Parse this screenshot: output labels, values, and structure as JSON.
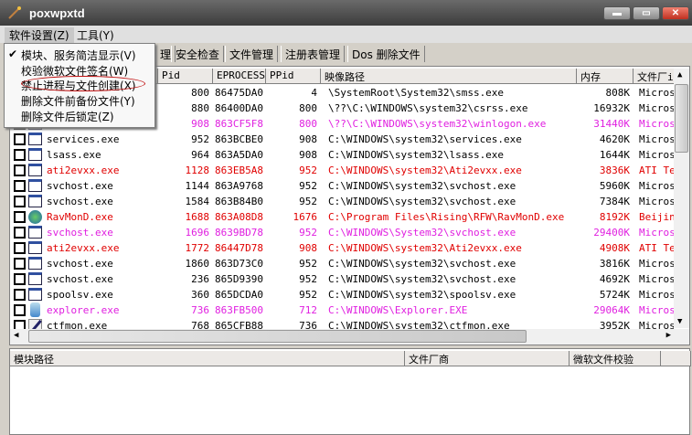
{
  "window": {
    "title": "poxwpxtd",
    "minimize": "▬",
    "maximize": "▭",
    "close": "✕"
  },
  "menubar": [
    {
      "label": "软件设置(Z)"
    },
    {
      "label": "工具(Y)"
    }
  ],
  "dropdown": {
    "items": [
      {
        "label": "模块、服务简洁显示(V)",
        "checked": true
      },
      {
        "label": "校验微软文件签名(W)"
      },
      {
        "label": "禁止进程与文件创建(X)",
        "highlighted": true
      },
      {
        "label": "删除文件前备份文件(Y)"
      },
      {
        "label": "删除文件后锁定(Z)"
      }
    ]
  },
  "tabs": [
    "理",
    "安全检查",
    "文件管理",
    "注册表管理",
    "Dos 删除文件"
  ],
  "table": {
    "columns": [
      "Pid",
      "EPROCESS",
      "PPid",
      "映像路径",
      "内存",
      "文件厂i"
    ],
    "rows": [
      {
        "name": "",
        "pid": "800",
        "eprocess": "86475DA0",
        "ppid": "4",
        "path": "\\SystemRoot\\System32\\smss.exe",
        "mem": "808K",
        "vendor": "Micros",
        "color": ""
      },
      {
        "name": "",
        "pid": "880",
        "eprocess": "86400DA0",
        "ppid": "800",
        "path": "\\??\\C:\\WINDOWS\\system32\\csrss.exe",
        "mem": "16932K",
        "vendor": "Micros",
        "color": ""
      },
      {
        "name": "",
        "pid": "908",
        "eprocess": "863CF5F8",
        "ppid": "800",
        "path": "\\??\\C:\\WINDOWS\\system32\\winlogon.exe",
        "mem": "31440K",
        "vendor": "Micros",
        "color": "m"
      },
      {
        "name": "services.exe",
        "pid": "952",
        "eprocess": "863BCBE0",
        "ppid": "908",
        "path": "C:\\WINDOWS\\system32\\services.exe",
        "mem": "4620K",
        "vendor": "Micros",
        "color": ""
      },
      {
        "name": "lsass.exe",
        "pid": "964",
        "eprocess": "863A5DA0",
        "ppid": "908",
        "path": "C:\\WINDOWS\\system32\\lsass.exe",
        "mem": "1644K",
        "vendor": "Micros",
        "color": ""
      },
      {
        "name": "ati2evxx.exe",
        "pid": "1128",
        "eprocess": "863EB5A8",
        "ppid": "952",
        "path": "C:\\WINDOWS\\system32\\Ati2evxx.exe",
        "mem": "3836K",
        "vendor": "ATI Te",
        "color": "r"
      },
      {
        "name": "svchost.exe",
        "pid": "1144",
        "eprocess": "863A9768",
        "ppid": "952",
        "path": "C:\\WINDOWS\\system32\\svchost.exe",
        "mem": "5960K",
        "vendor": "Micros",
        "color": ""
      },
      {
        "name": "svchost.exe",
        "pid": "1584",
        "eprocess": "863B84B0",
        "ppid": "952",
        "path": "C:\\WINDOWS\\system32\\svchost.exe",
        "mem": "7384K",
        "vendor": "Micros",
        "color": ""
      },
      {
        "name": "RavMonD.exe",
        "pid": "1688",
        "eprocess": "863A08D8",
        "ppid": "1676",
        "path": "C:\\Program Files\\Rising\\RFW\\RavMonD.exe",
        "mem": "8192K",
        "vendor": "Beijin",
        "color": "r",
        "icon": "globe"
      },
      {
        "name": "svchost.exe",
        "pid": "1696",
        "eprocess": "8639BD78",
        "ppid": "952",
        "path": "C:\\WINDOWS\\System32\\svchost.exe",
        "mem": "29400K",
        "vendor": "Micros",
        "color": "m"
      },
      {
        "name": "ati2evxx.exe",
        "pid": "1772",
        "eprocess": "86447D78",
        "ppid": "908",
        "path": "C:\\WINDOWS\\system32\\Ati2evxx.exe",
        "mem": "4908K",
        "vendor": "ATI Te",
        "color": "r"
      },
      {
        "name": "svchost.exe",
        "pid": "1860",
        "eprocess": "863D73C0",
        "ppid": "952",
        "path": "C:\\WINDOWS\\system32\\svchost.exe",
        "mem": "3816K",
        "vendor": "Micros",
        "color": ""
      },
      {
        "name": "svchost.exe",
        "pid": "236",
        "eprocess": "865D9390",
        "ppid": "952",
        "path": "C:\\WINDOWS\\system32\\svchost.exe",
        "mem": "4692K",
        "vendor": "Micros",
        "color": ""
      },
      {
        "name": "spoolsv.exe",
        "pid": "360",
        "eprocess": "865DCDA0",
        "ppid": "952",
        "path": "C:\\WINDOWS\\system32\\spoolsv.exe",
        "mem": "5724K",
        "vendor": "Micros",
        "color": ""
      },
      {
        "name": "explorer.exe",
        "pid": "736",
        "eprocess": "863FB500",
        "ppid": "712",
        "path": "C:\\WINDOWS\\Explorer.EXE",
        "mem": "29064K",
        "vendor": "Micros",
        "color": "m",
        "icon": "explorer"
      },
      {
        "name": "ctfmon.exe",
        "pid": "768",
        "eprocess": "865CFB88",
        "ppid": "736",
        "path": "C:\\WINDOWS\\system32\\ctfmon.exe",
        "mem": "3952K",
        "vendor": "Micros",
        "color": "",
        "icon": "pen"
      }
    ]
  },
  "lower": {
    "columns": [
      "模块路径",
      "文件厂商",
      "微软文件校验"
    ]
  },
  "colors": {
    "red": "#e00000",
    "magenta": "#e020e0"
  }
}
